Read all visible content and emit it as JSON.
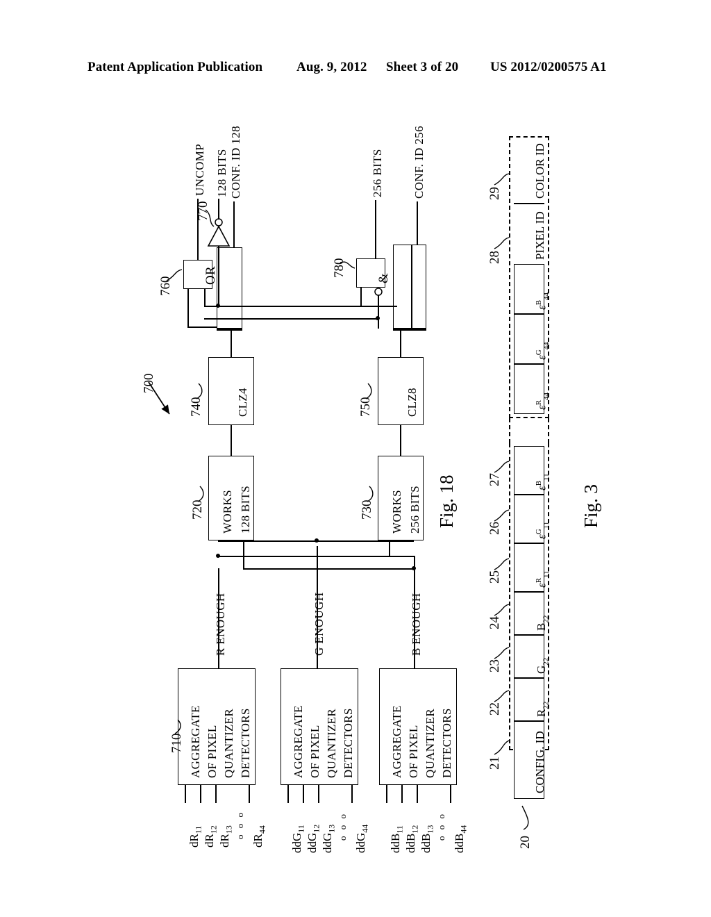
{
  "header": {
    "publication": "Patent Application Publication",
    "date": "Aug. 9, 2012",
    "sheet": "Sheet 3 of 20",
    "number": "US 2012/0200575 A1"
  },
  "fig18": {
    "caption": "Fig. 18",
    "ref_main": "700",
    "blocks": [
      {
        "ref": "710",
        "lines": [
          "AGGREGATE",
          "OF PIXEL",
          "QUANTIZER",
          "DETECTORS"
        ]
      },
      {
        "ref": "",
        "lines": [
          "AGGREGATE",
          "OF PIXEL",
          "QUANTIZER",
          "DETECTORS"
        ]
      },
      {
        "ref": "",
        "lines": [
          "AGGREGATE",
          "OF PIXEL",
          "QUANTIZER",
          "DETECTORS"
        ]
      }
    ],
    "works": [
      {
        "ref": "720",
        "lines": [
          "WORKS",
          "128 BITS"
        ]
      },
      {
        "ref": "730",
        "lines": [
          "WORKS",
          "256 BITS"
        ]
      }
    ],
    "clz": [
      {
        "ref": "740",
        "label": "CLZ4"
      },
      {
        "ref": "750",
        "label": "CLZ8"
      }
    ],
    "gates": [
      {
        "ref": "760",
        "label": "OR"
      },
      {
        "ref": "770",
        "label": ""
      },
      {
        "ref": "780",
        "label": "&"
      }
    ],
    "enough_signals": [
      "R ENOUGH",
      "G ENOUGH",
      "B ENOUGH"
    ],
    "outputs": [
      "UNCOMP",
      "128 BITS",
      "CONF. ID 128",
      "256 BITS",
      "CONF. ID 256"
    ],
    "inputs": [
      {
        "items": [
          "dR11",
          "dR12",
          "dR13",
          "dR44"
        ],
        "ellipsis": "o o o"
      },
      {
        "items": [
          "ddG11",
          "ddG12",
          "ddG13",
          "ddG44"
        ],
        "ellipsis": "o o o"
      },
      {
        "items": [
          "ddB11",
          "ddB12",
          "ddB13",
          "ddB44"
        ],
        "ellipsis": "o o o"
      }
    ]
  },
  "fig3": {
    "caption": "Fig. 3",
    "ref_main": "20",
    "cells": [
      {
        "ref": "21",
        "label": "CONFIG. ID",
        "dashed": false
      },
      {
        "ref": "22",
        "label": "R22",
        "dashed": false
      },
      {
        "ref": "23",
        "label": "G22",
        "dashed": false
      },
      {
        "ref": "24",
        "label": "B22",
        "dashed": false
      },
      {
        "ref": "25",
        "label": "εR11",
        "dashed": false
      },
      {
        "ref": "26",
        "label": "εG11",
        "dashed": false
      },
      {
        "ref": "27",
        "label": "εB11",
        "dashed": false
      },
      {
        "ref": "",
        "label": "εR44",
        "dashed": false
      },
      {
        "ref": "",
        "label": "εG44",
        "dashed": false
      },
      {
        "ref": "",
        "label": "εB44",
        "dashed": false
      },
      {
        "ref": "28",
        "label": "PIXEL ID",
        "dashed": true
      },
      {
        "ref": "29",
        "label": "COLOR ID",
        "dashed": true
      }
    ]
  }
}
